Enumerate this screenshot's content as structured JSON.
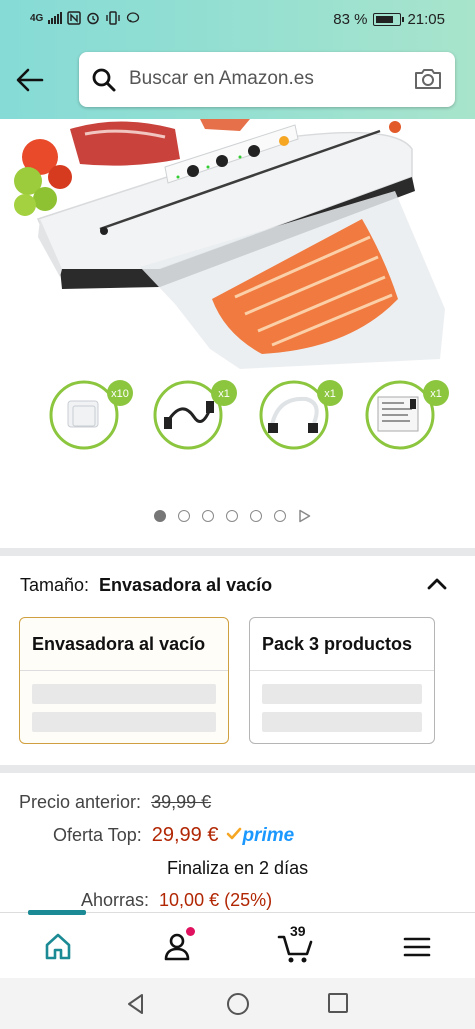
{
  "status_bar": {
    "network": "4G",
    "battery_percent": "83 %",
    "battery_level": 0.83,
    "time": "21:05"
  },
  "search": {
    "placeholder": "Buscar en Amazon.es",
    "back_icon": "arrow-left-icon",
    "search_icon": "search-icon",
    "camera_icon": "camera-icon"
  },
  "product": {
    "image_count": 7,
    "active_image": 1,
    "accessories": [
      {
        "name": "vacuum-bags",
        "badge": "x10"
      },
      {
        "name": "power-cable",
        "badge": "x1"
      },
      {
        "name": "vacuum-hose",
        "badge": "x1"
      },
      {
        "name": "instruction-manual",
        "badge": "x1"
      }
    ]
  },
  "size": {
    "label": "Tamaño:",
    "selected_value": "Envasadora al vacío",
    "options": [
      {
        "label": "Envasadora al vacío",
        "selected": true
      },
      {
        "label": "Pack 3 productos",
        "selected": false
      }
    ]
  },
  "price": {
    "previous_label": "Precio anterior:",
    "previous_value": "39,99 €",
    "offer_label": "Oferta Top:",
    "offer_value": "29,99 €",
    "prime": "prime",
    "ends": "Finaliza en 2 días",
    "savings_label": "Ahorras:",
    "savings_value": "10,00 € (25%)"
  },
  "bottom_nav": {
    "items": [
      {
        "icon": "home-icon",
        "active": true
      },
      {
        "icon": "account-icon",
        "notification": true
      },
      {
        "icon": "cart-icon",
        "count": "39"
      },
      {
        "icon": "menu-icon"
      }
    ]
  },
  "colors": {
    "header_start": "#86dbd6",
    "header_end": "#a8e4cc",
    "price": "#b12704",
    "prime": "#1a98ff",
    "selected_border": "#d0a040",
    "nav_accent": "#1b8a94",
    "notification": "#e0115f"
  }
}
